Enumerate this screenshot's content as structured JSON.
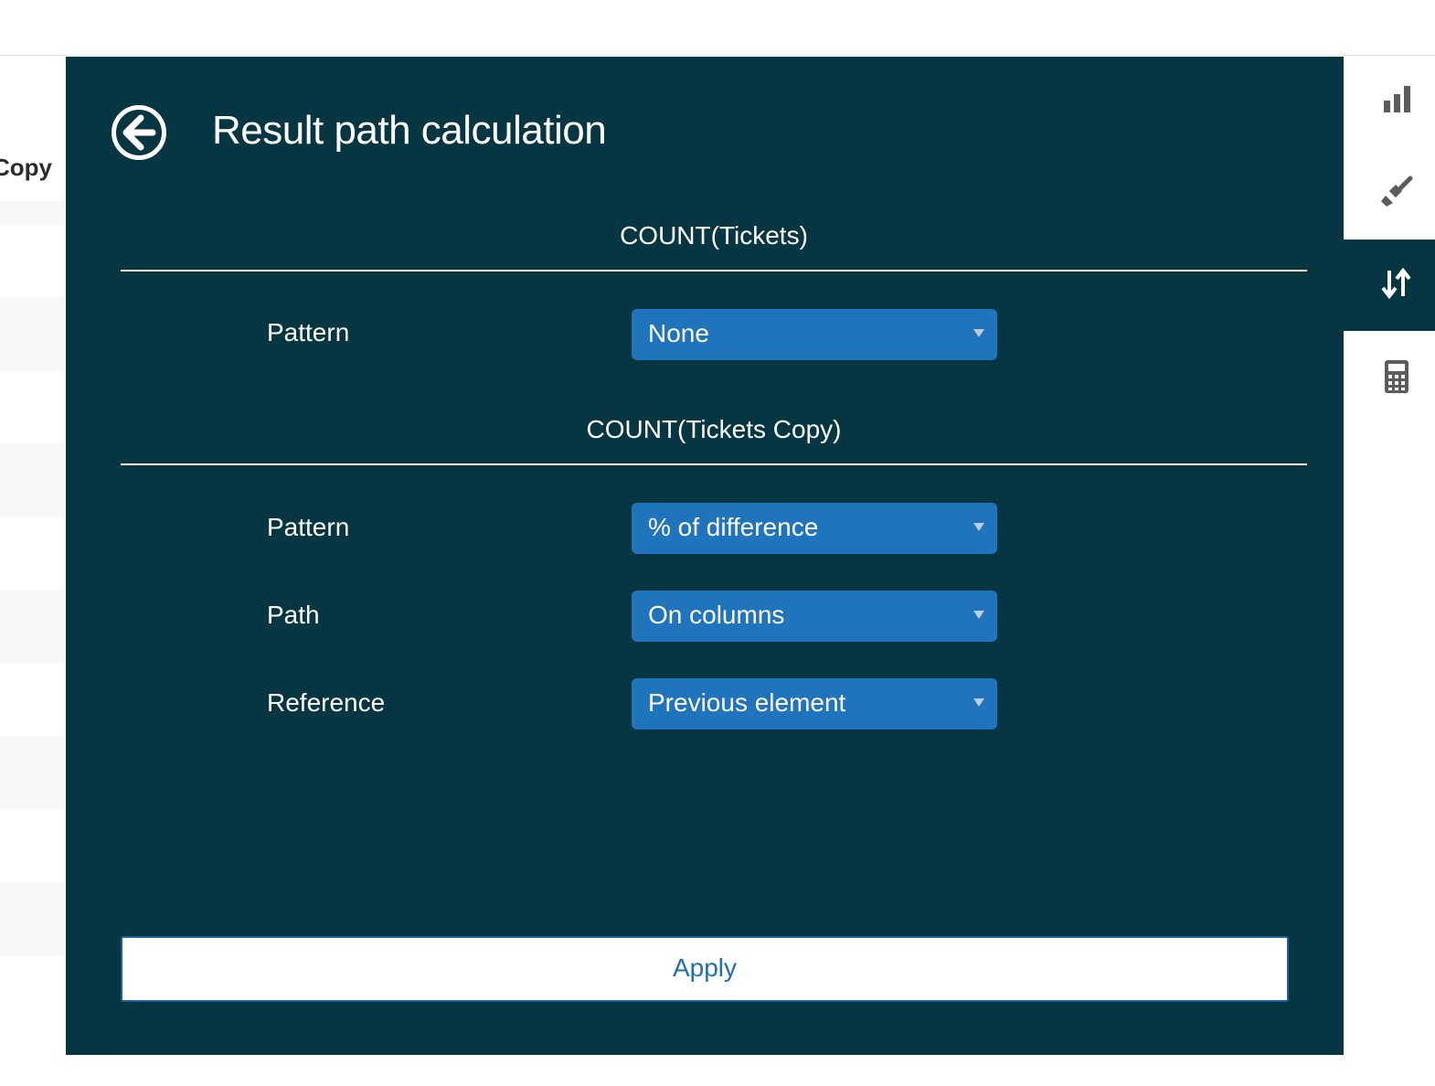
{
  "background": {
    "column_header": "Copy"
  },
  "panel": {
    "title": "Result path calculation",
    "sections": [
      {
        "heading": "COUNT(Tickets)",
        "fields": [
          {
            "label": "Pattern",
            "value": "None"
          }
        ]
      },
      {
        "heading": "COUNT(Tickets Copy)",
        "fields": [
          {
            "label": "Pattern",
            "value": "% of difference"
          },
          {
            "label": "Path",
            "value": "On columns"
          },
          {
            "label": "Reference",
            "value": "Previous element"
          }
        ]
      }
    ],
    "apply_label": "Apply"
  },
  "toolbar": {
    "tools": [
      {
        "icon": "bar-chart-icon",
        "active": false
      },
      {
        "icon": "brush-icon",
        "active": false
      },
      {
        "icon": "sort-arrows-icon",
        "active": true
      },
      {
        "icon": "calculator-icon",
        "active": false
      }
    ]
  },
  "colors": {
    "panel_bg": "#053642",
    "select_bg": "#1f74bb",
    "apply_text": "#1f6fb2"
  }
}
